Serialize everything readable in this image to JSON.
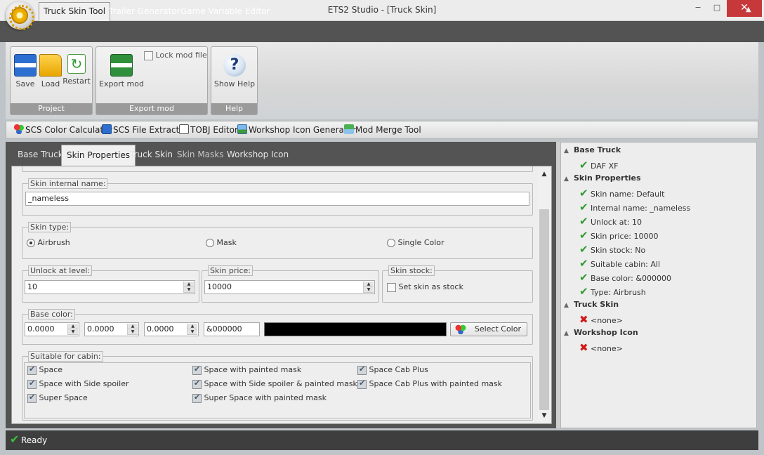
{
  "window": {
    "title": "ETS2 Studio - [Truck Skin]",
    "minimize": "‒",
    "maximize": "□",
    "close": "✕"
  },
  "ribbon_tabs": [
    "Truck Skin Tool",
    "Trailer Generator",
    "Game Variable Editor"
  ],
  "ribbon": {
    "project": {
      "label": "Project",
      "save": "Save",
      "load": "Load",
      "restart": "Restart"
    },
    "export": {
      "label": "Export mod",
      "export_mod": "Export mod",
      "lock_mod_file": "Lock mod file"
    },
    "help": {
      "label": "Help",
      "show_help": "Show Help"
    }
  },
  "tools": [
    "SCS Color Calculator",
    "SCS File Extractor",
    "TOBJ Editor",
    "Workshop Icon Generator",
    "Mod Merge Tool"
  ],
  "panel_tabs": [
    "Base Truck",
    "Skin Properties",
    "Truck Skin",
    "Skin Masks",
    "Workshop Icon"
  ],
  "form": {
    "skin_internal_name": {
      "label": "Skin internal name:",
      "value": "_nameless"
    },
    "skin_type": {
      "label": "Skin type:",
      "options": [
        "Airbrush",
        "Mask",
        "Single Color"
      ],
      "selected": "Airbrush"
    },
    "unlock_level": {
      "label": "Unlock at level:",
      "value": "10"
    },
    "skin_price": {
      "label": "Skin price:",
      "value": "10000"
    },
    "skin_stock": {
      "label": "Skin stock:",
      "checkbox": "Set skin as stock"
    },
    "base_color": {
      "label": "Base color:",
      "r": "0.0000",
      "g": "0.0000",
      "b": "0.0000",
      "hex": "&000000",
      "swatch": "#000000",
      "select_button": "Select Color"
    },
    "cabins": {
      "label": "Suitable for cabin:",
      "col1": [
        "Space",
        "Space with Side spoiler",
        "Super Space"
      ],
      "col2": [
        "Space with painted mask",
        "Space with Side spoiler & painted mask",
        "Super Space with painted mask"
      ],
      "col3": [
        "Space Cab Plus",
        "Space Cab Plus with painted mask"
      ]
    }
  },
  "summary": {
    "base_truck": {
      "head": "Base Truck",
      "items": [
        "DAF XF"
      ]
    },
    "skin_properties": {
      "head": "Skin Properties",
      "items": [
        "Skin name: Default",
        "Internal name: _nameless",
        "Unlock at: 10",
        "Skin price: 10000",
        "Skin stock: No",
        "Suitable cabin: All",
        "Base color: &000000",
        "Type: Airbrush"
      ]
    },
    "truck_skin": {
      "head": "Truck Skin",
      "items": [
        "<none>"
      ]
    },
    "workshop_icon": {
      "head": "Workshop Icon",
      "items": [
        "<none>"
      ]
    }
  },
  "status": "Ready",
  "colors": {
    "ok": "#2e9b2e",
    "error": "#d01a1a",
    "close": "#c7383b"
  }
}
